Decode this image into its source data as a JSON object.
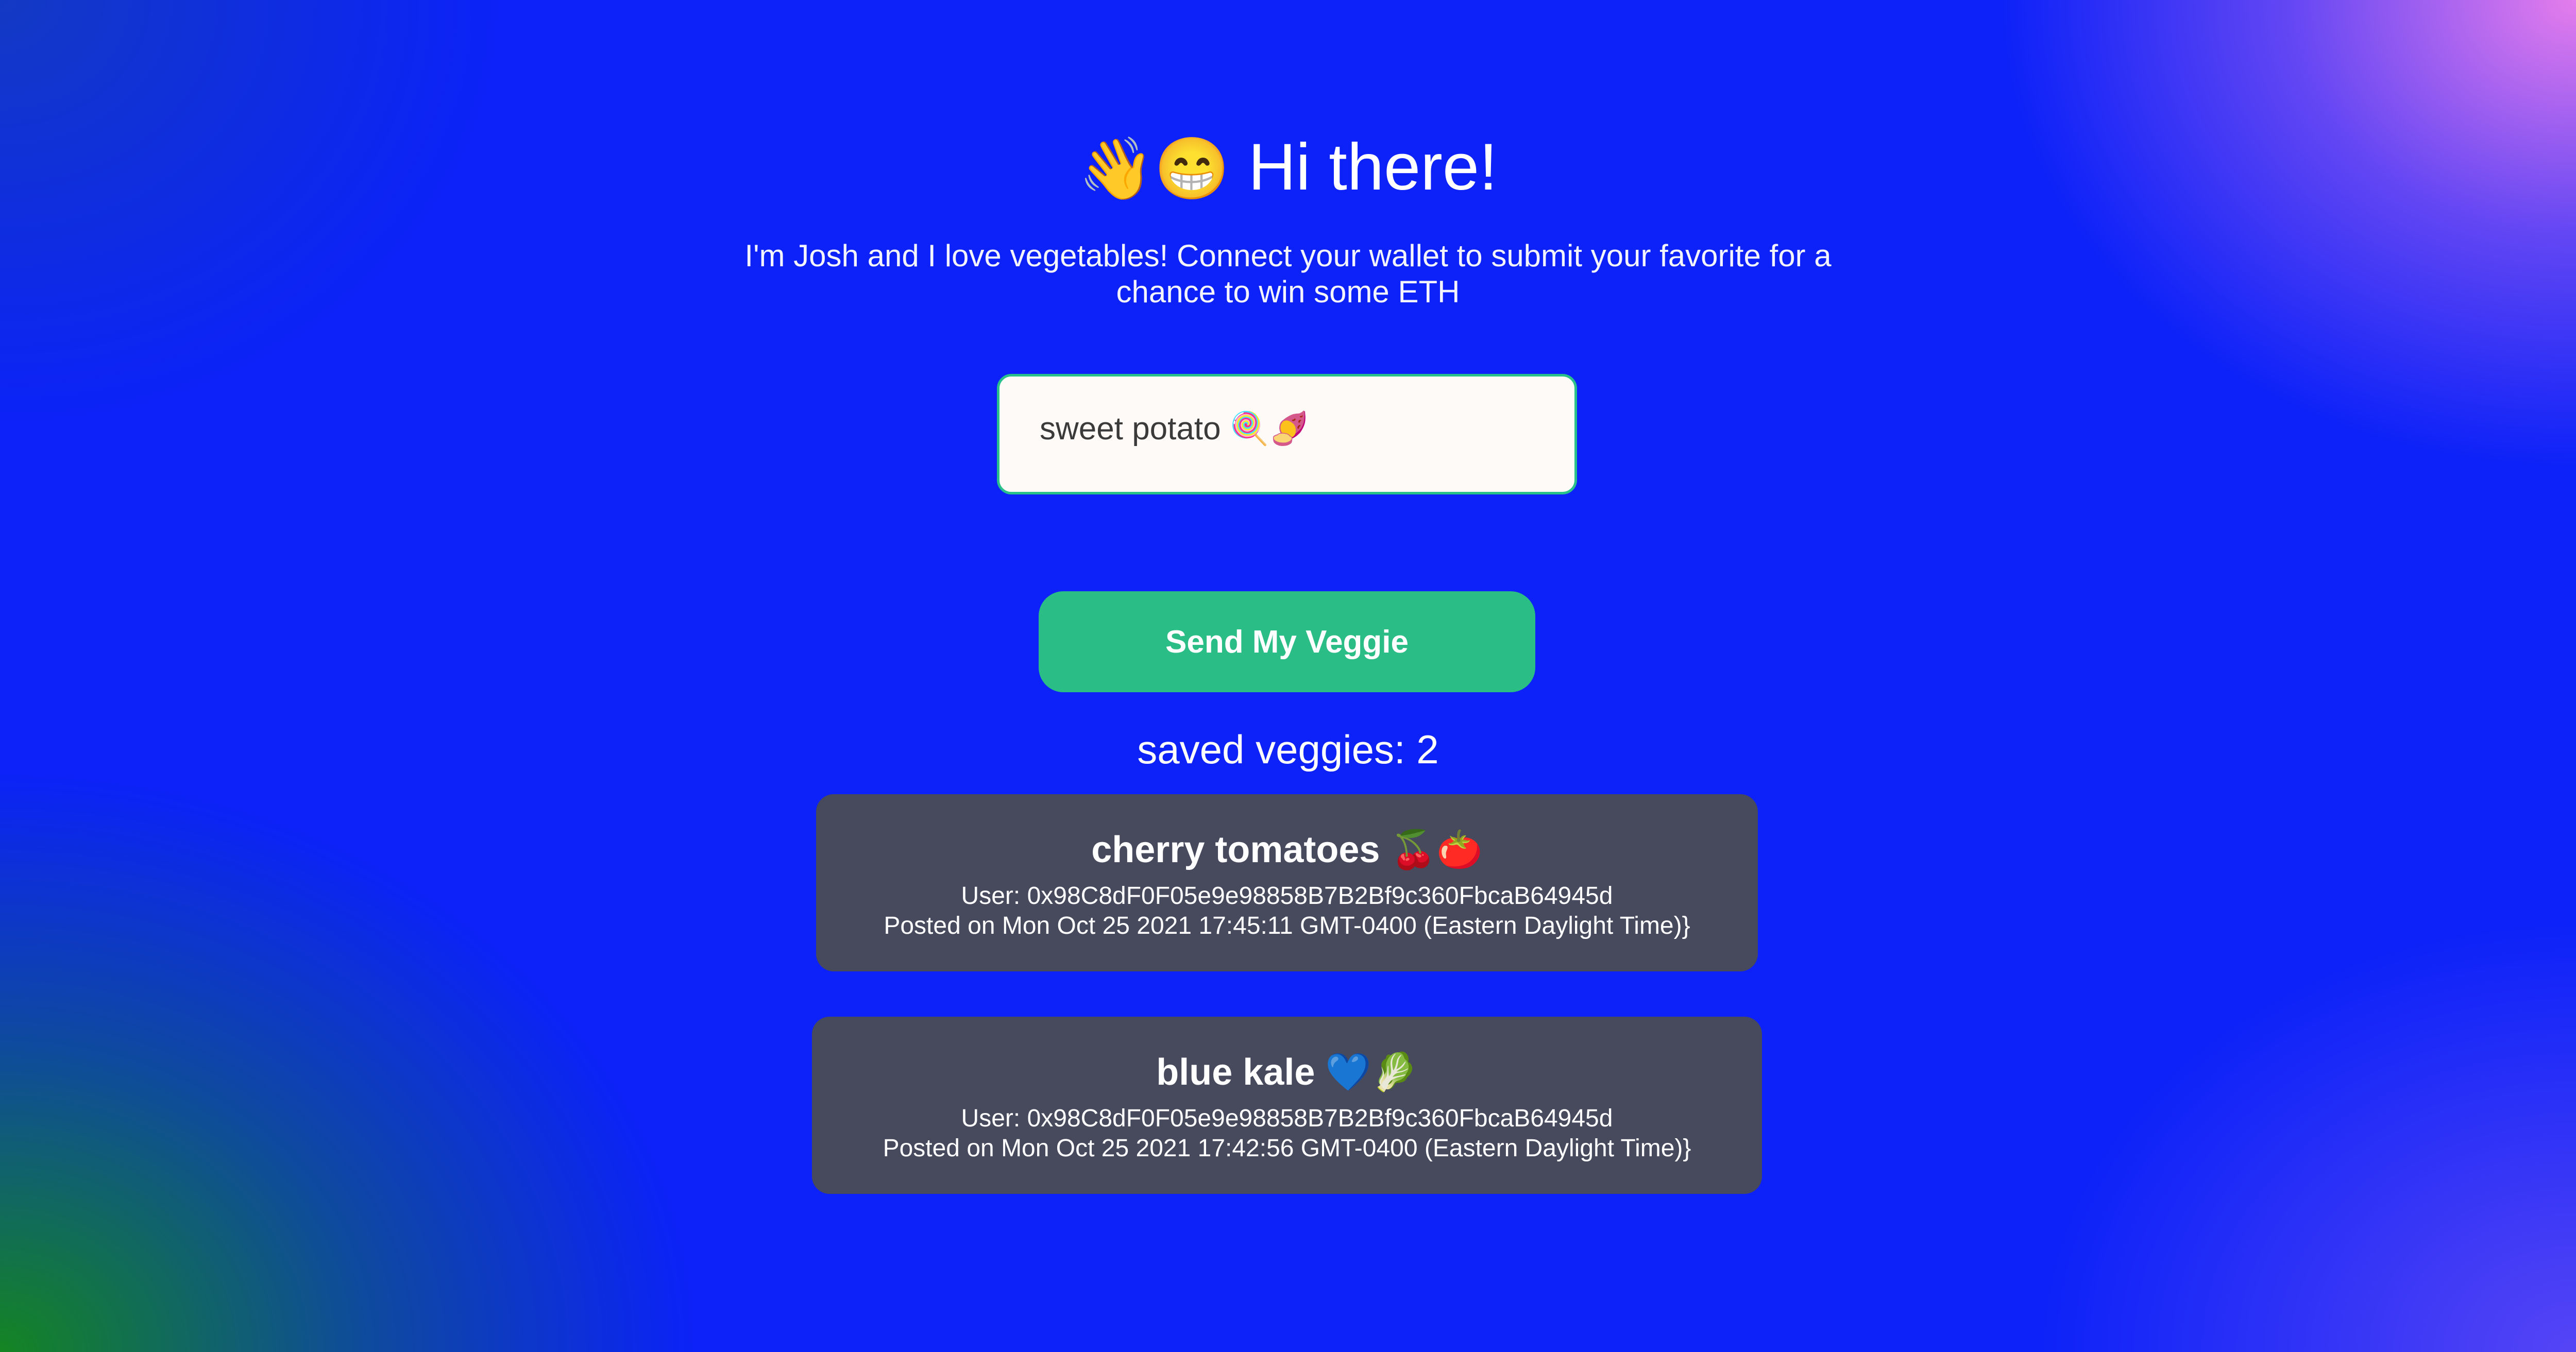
{
  "header": {
    "wave_emoji": "👋",
    "smile_emoji": "😁",
    "title": "Hi there!",
    "subtitle": "I'm Josh and I love vegetables! Connect your wallet to submit your favorite for a chance to win some ETH"
  },
  "form": {
    "input_value": "sweet potato 🍭🍠",
    "submit_label": "Send My Veggie"
  },
  "saved": {
    "label": "saved veggies: 2"
  },
  "veggies": [
    {
      "title": "cherry tomatoes 🍒🍅",
      "user": "User: 0x98C8dF0F05e9e98858B7B2Bf9c360FbcaB64945d",
      "posted": "Posted on Mon Oct 25 2021 17:45:11 GMT-0400 (Eastern Daylight Time)}"
    },
    {
      "title": "blue kale 💙🥬",
      "user": "User: 0x98C8dF0F05e9e98858B7B2Bf9c360FbcaB64945d",
      "posted": "Posted on Mon Oct 25 2021 17:42:56 GMT-0400 (Eastern Daylight Time)}"
    }
  ],
  "colors": {
    "accent": "#2abd85",
    "card_background": "#474a5d",
    "input_background": "#fefaf8"
  }
}
